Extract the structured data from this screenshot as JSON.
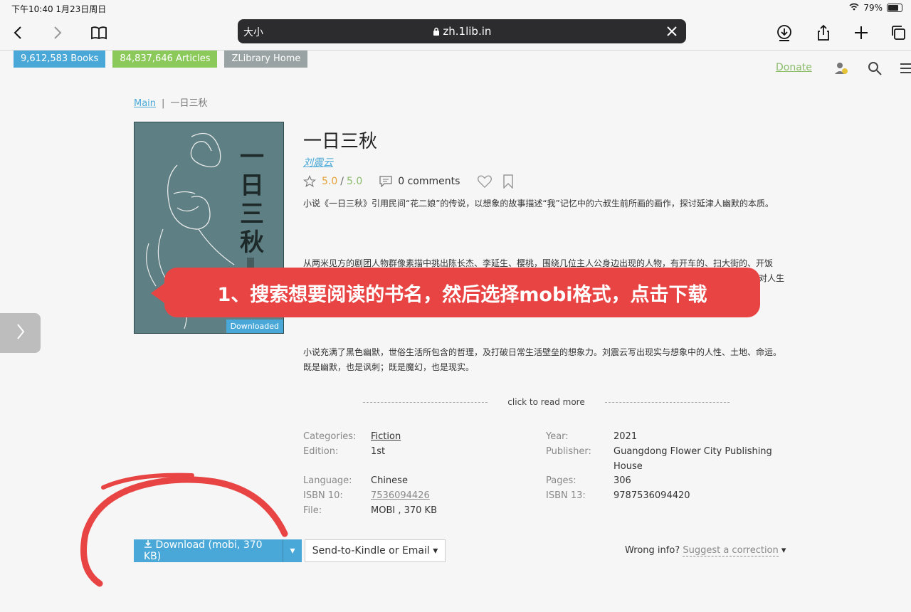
{
  "status_bar": {
    "time": "下午10:40  1月23日周日",
    "battery": "79%",
    "battery_level": 0.79
  },
  "browser": {
    "text_size_label": "大小",
    "url": "zh.1lib.in",
    "icons": [
      "back-icon",
      "forward-icon",
      "bookmarks-icon",
      "lock-icon",
      "close-icon",
      "download-icon",
      "share-icon",
      "plus-icon",
      "tabs-icon"
    ]
  },
  "nav": {
    "books": "9,612,583 Books",
    "articles": "84,837,646 Articles",
    "home": "ZLibrary Home",
    "donate": "Donate"
  },
  "breadcrumb": {
    "main": "Main",
    "current": "一日三秋"
  },
  "book": {
    "title": "一日三秋",
    "author": "刘震云",
    "rating": "5.0",
    "rating_max": "5.0",
    "comments": "0 comments",
    "cover_title": "一日三秋",
    "cover_badge": "Downloaded",
    "desc1": "小说《一日三秋》引用民间“花二娘”的传说，以想象的故事描述“我”记忆中的六叔生前所画的画作，探讨延津人幽默的本质。",
    "desc2": "从两米见方的剧团人物群像素描中挑出陈长杰、李延生、樱桃，围绕几位主人公身边出现的人物，有开车的、扫大街的、开饭",
    "desc2b": "对人生",
    "desc3": "小说充满了黑色幽默，世俗生活所包含的哲理，及打破日常生活壁垒的想象力。刘震云写出现实与想象中的人性、土地、命运。既是幽默，也是讽刺；既是魔幻，也是现实。",
    "read_more": "click to read more"
  },
  "properties": {
    "categories_label": "Categories:",
    "categories": "Fiction",
    "edition_label": "Edition:",
    "edition": "1st",
    "language_label": "Language:",
    "language": "Chinese",
    "isbn10_label": "ISBN 10:",
    "isbn10": "7536094426",
    "file_label": "File:",
    "file": "MOBI , 370 KB",
    "year_label": "Year:",
    "year": "2021",
    "publisher_label": "Publisher:",
    "publisher": "Guangdong Flower City Publishing House",
    "pages_label": "Pages:",
    "pages": "306",
    "isbn13_label": "ISBN 13:",
    "isbn13": "9787536094420"
  },
  "actions": {
    "download": "Download (mobi, 370 KB)",
    "send": "Send-to-Kindle or Email",
    "wrong_info": "Wrong info?",
    "suggest": "Suggest a correction"
  },
  "annotation": {
    "callout": "1、搜索想要阅读的书名，然后选择mobi格式，点击下载",
    "color": "#e94444"
  }
}
